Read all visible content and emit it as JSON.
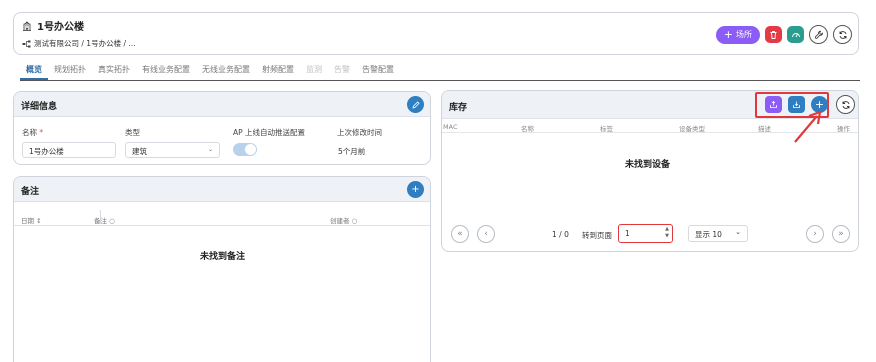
{
  "header": {
    "title": "1号办公楼",
    "building_icon": "building-icon",
    "breadcrumb": "测试有限公司 / 1号办公楼 / ...",
    "breadcrumb_icon": "sitemap-icon",
    "add_site_label": "场所",
    "colors": {
      "purple": "#8b5cf6",
      "red": "#e63946",
      "teal": "#2a9d8f"
    }
  },
  "tabs": [
    {
      "label": "概览",
      "state": "active"
    },
    {
      "label": "规划拓扑",
      "state": "normal"
    },
    {
      "label": "真实拓扑",
      "state": "normal"
    },
    {
      "label": "有线业务配置",
      "state": "normal"
    },
    {
      "label": "无线业务配置",
      "state": "normal"
    },
    {
      "label": "射频配置",
      "state": "normal"
    },
    {
      "label": "监测",
      "state": "disabled"
    },
    {
      "label": "告警",
      "state": "disabled"
    },
    {
      "label": "告警配置",
      "state": "normal"
    }
  ],
  "detail": {
    "title": "详细信息",
    "name_label": "名称",
    "required_mark": "*",
    "name_value": "1号办公楼",
    "type_label": "类型",
    "type_value": "建筑",
    "ap_label": "AP 上线自动推送配置",
    "ap_enabled": true,
    "modified_label": "上次修改时间",
    "modified_value": "5个月前"
  },
  "notes": {
    "title": "备注",
    "columns": [
      "日期",
      "备注",
      "创建者"
    ],
    "empty": "未找到备注"
  },
  "inventory": {
    "title": "库存",
    "columns": [
      "MAC",
      "名称",
      "标签",
      "设备类型",
      "描述",
      "操作"
    ],
    "empty": "未找到设备",
    "page_info": "1 / 0",
    "goto_label": "转到页面",
    "page_value": "1",
    "show_label": "显示 10"
  }
}
